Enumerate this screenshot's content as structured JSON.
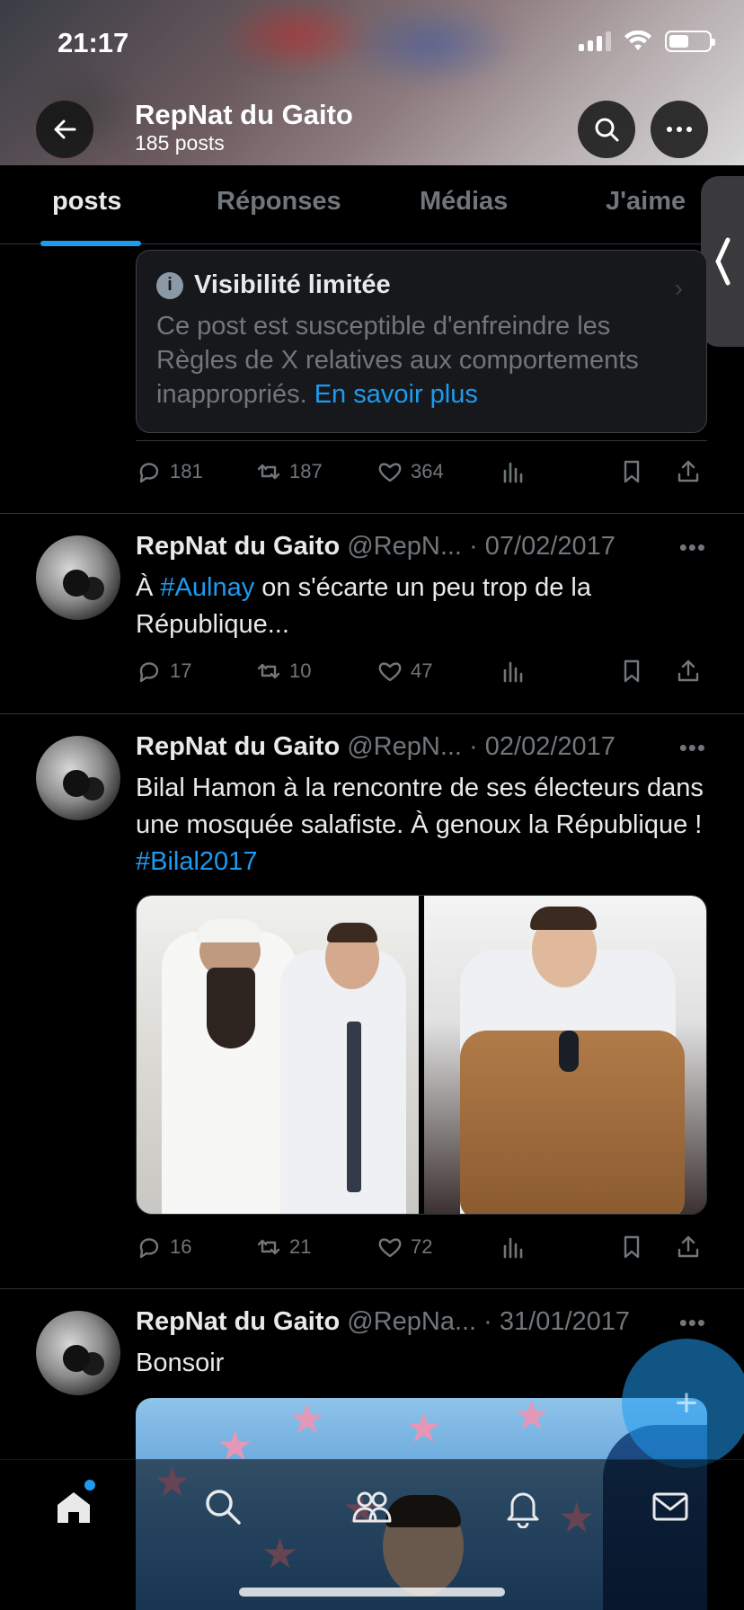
{
  "status_bar": {
    "time": "21:17"
  },
  "header": {
    "title": "RepNat du Gaito",
    "posts_count": "185 posts",
    "back_icon": "arrow-left-icon",
    "search_icon": "search-icon",
    "more_icon": "more-horizontal-icon"
  },
  "tabs": [
    {
      "label": "posts",
      "active": true
    },
    {
      "label": "Réponses"
    },
    {
      "label": "Médias"
    },
    {
      "label": "J'aime"
    }
  ],
  "limited_post": {
    "notice_title": "Visibilité limitée",
    "notice_body": "Ce post est susceptible d'enfreindre les Règles de X relatives aux comportements inappropriés.",
    "notice_link": "En savoir plus",
    "replies": "181",
    "reposts": "187",
    "likes": "364"
  },
  "tweets": [
    {
      "name": "RepNat du Gaito",
      "meta": "@RepN... · 07/02/2017",
      "text_prefix": "À ",
      "hashtag": "#Aulnay",
      "text_suffix": " on s'écarte un peu trop de la République...",
      "replies": "17",
      "reposts": "10",
      "likes": "47"
    },
    {
      "name": "RepNat du Gaito",
      "meta": "@RepN... · 02/02/2017",
      "text_prefix": "Bilal Hamon à la rencontre de ses électeurs dans une mosquée salafiste. À genoux la République ! ",
      "hashtag": "#Bilal2017",
      "replies": "16",
      "reposts": "21",
      "likes": "72"
    },
    {
      "name": "RepNat du Gaito",
      "meta": "@RepNa... · 31/01/2017",
      "text": "Bonsoir"
    }
  ],
  "more_label": "•••",
  "fab_label": "+",
  "accent_color": "#1d9bf0"
}
